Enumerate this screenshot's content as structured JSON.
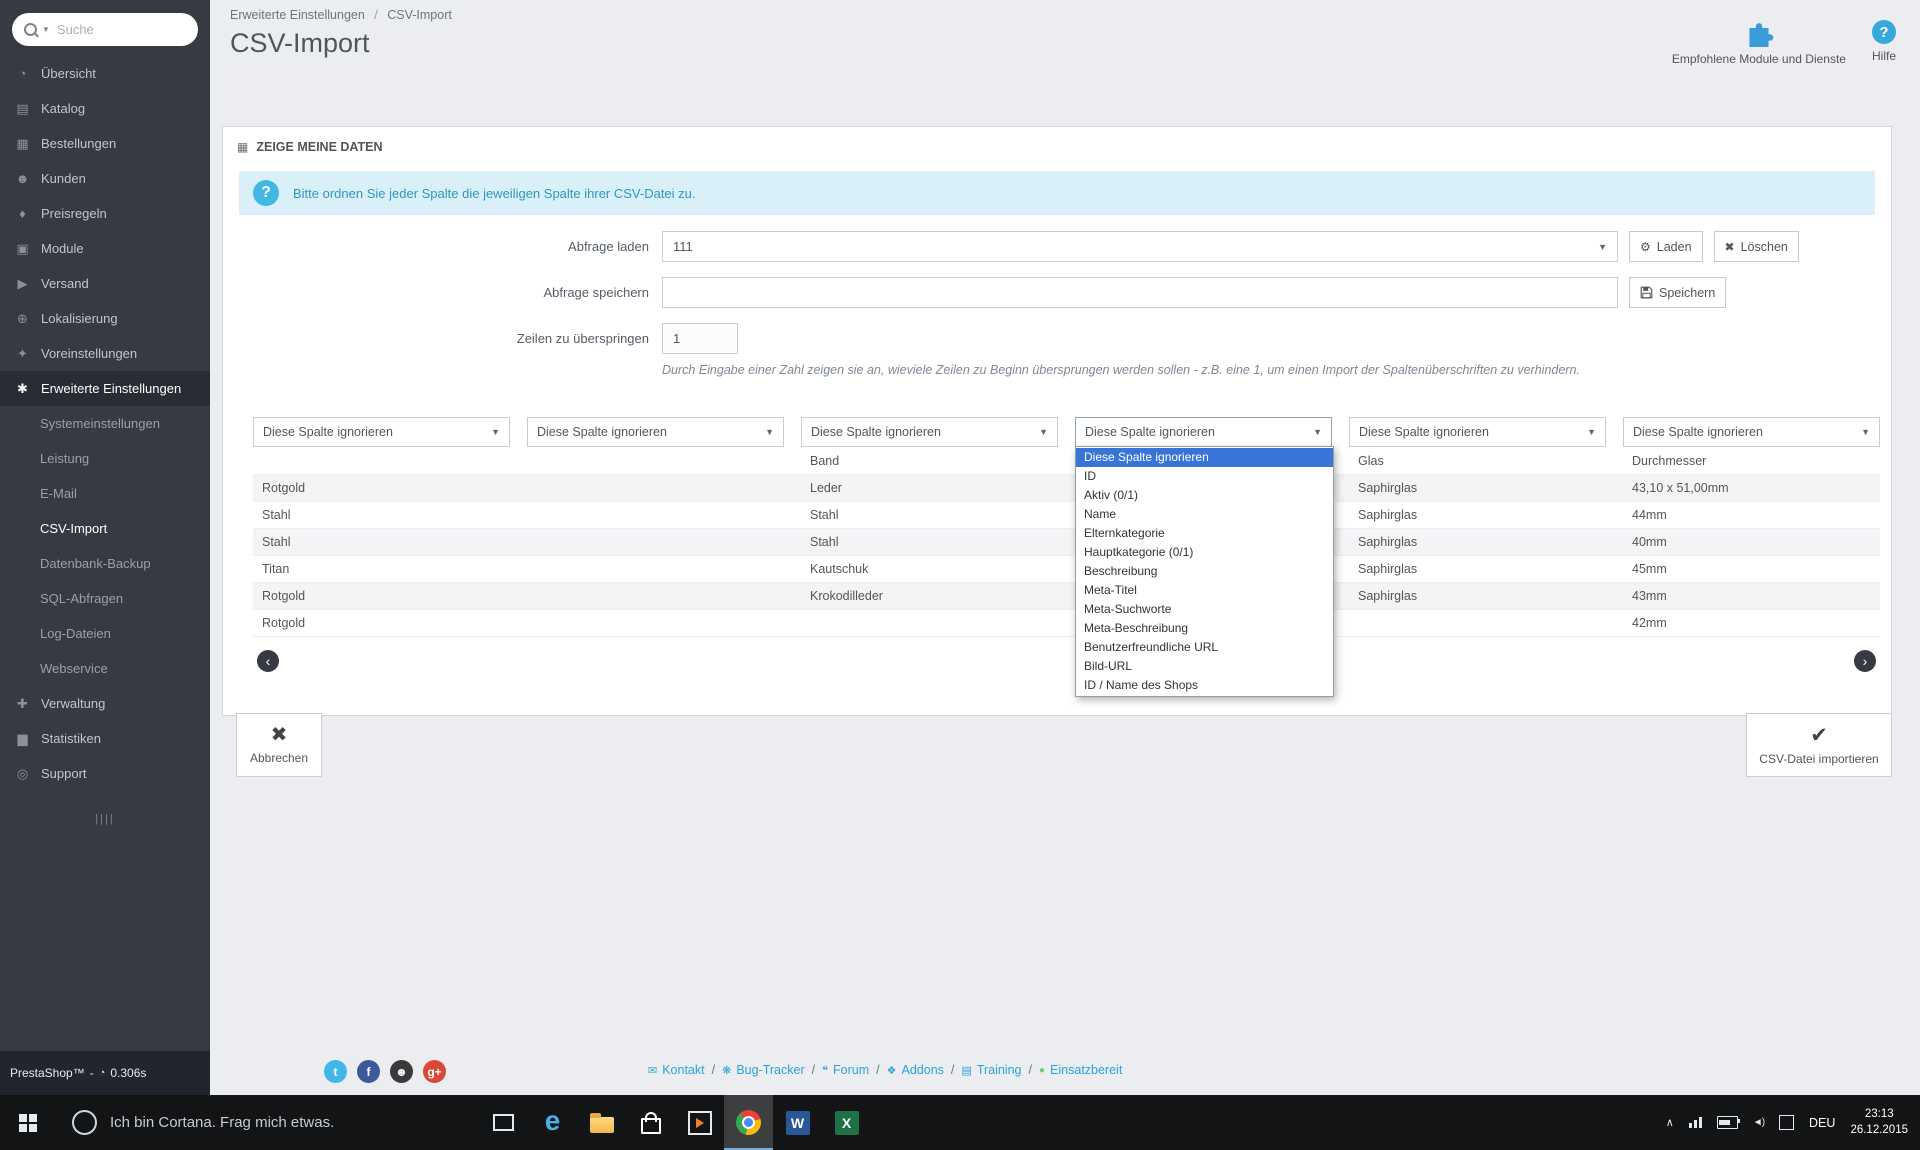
{
  "sidebar": {
    "search_placeholder": "Suche",
    "menu": [
      {
        "label": "Übersicht",
        "icon": "dashboard-icon",
        "type": "main"
      },
      {
        "label": "Katalog",
        "icon": "catalog-icon",
        "type": "main"
      },
      {
        "label": "Bestellungen",
        "icon": "orders-icon",
        "type": "main"
      },
      {
        "label": "Kunden",
        "icon": "customers-icon",
        "type": "main"
      },
      {
        "label": "Preisregeln",
        "icon": "price-rules-icon",
        "type": "main"
      },
      {
        "label": "Module",
        "icon": "modules-icon",
        "type": "main"
      },
      {
        "label": "Versand",
        "icon": "shipping-icon",
        "type": "main"
      },
      {
        "label": "Lokalisierung",
        "icon": "localization-icon",
        "type": "main"
      },
      {
        "label": "Voreinstellungen",
        "icon": "preferences-icon",
        "type": "main"
      },
      {
        "label": "Erweiterte Einstellungen",
        "icon": "advanced-settings-icon",
        "type": "main",
        "active": true
      },
      {
        "label": "Systemeinstellungen",
        "type": "sub"
      },
      {
        "label": "Leistung",
        "type": "sub"
      },
      {
        "label": "E-Mail",
        "type": "sub"
      },
      {
        "label": "CSV-Import",
        "type": "sub",
        "active": true
      },
      {
        "label": "Datenbank-Backup",
        "type": "sub"
      },
      {
        "label": "SQL-Abfragen",
        "type": "sub"
      },
      {
        "label": "Log-Dateien",
        "type": "sub"
      },
      {
        "label": "Webservice",
        "type": "sub"
      },
      {
        "label": "Verwaltung",
        "icon": "administration-icon",
        "type": "main"
      },
      {
        "label": "Statistiken",
        "icon": "stats-icon",
        "type": "main"
      },
      {
        "label": "Support",
        "icon": "support-icon",
        "type": "main"
      }
    ],
    "footer": {
      "brand": "PrestaShop™",
      "separator": "-",
      "load_time": "0.306s"
    }
  },
  "header": {
    "breadcrumb_parent": "Erweiterte Einstellungen",
    "breadcrumb_separator": "/",
    "breadcrumb_current": "CSV-Import",
    "title": "CSV-Import",
    "modules_label": "Empfohlene Module und Dienste",
    "help_label": "Hilfe"
  },
  "panel": {
    "heading": "ZEIGE MEINE DATEN",
    "alert_text": "Bitte ordnen Sie jeder Spalte die jeweiligen Spalte ihrer CSV-Datei zu.",
    "form": {
      "load_label": "Abfrage laden",
      "load_value": "111",
      "load_button": "Laden",
      "delete_button": "Löschen",
      "save_label": "Abfrage speichern",
      "save_value": "",
      "save_button": "Speichern",
      "skip_label": "Zeilen zu überspringen",
      "skip_value": "1",
      "skip_help": "Durch Eingabe einer Zahl zeigen sie an, wieviele Zeilen zu Beginn übersprungen werden sollen - z.B. eine 1, um einen Import der Spaltenüberschriften zu verhindern."
    },
    "mapping": {
      "ignore_label": "Diese Spalte ignorieren",
      "column_count": 6,
      "open_column_index": 3,
      "dropdown": {
        "selected_index": 0,
        "options": [
          "Diese Spalte ignorieren",
          "ID",
          "Aktiv (0/1)",
          "Name",
          "Elternkategorie",
          "Hauptkategorie (0/1)",
          "Beschreibung",
          "Meta-Titel",
          "Meta-Suchworte",
          "Meta-Beschreibung",
          "Benutzerfreundliche URL",
          "Bild-URL",
          "ID / Name des Shops"
        ]
      },
      "rows": [
        [
          "",
          "",
          "Band",
          "",
          "Glas",
          "Durchmesser"
        ],
        [
          "Rotgold",
          "",
          "Leder",
          "",
          "Saphirglas",
          "43,10 x 51,00mm"
        ],
        [
          "Stahl",
          "",
          "Stahl",
          "",
          "Saphirglas",
          "44mm"
        ],
        [
          "Stahl",
          "",
          "Stahl",
          "",
          "Saphirglas",
          "40mm"
        ],
        [
          "Titan",
          "",
          "Kautschuk",
          "",
          "Saphirglas",
          "45mm"
        ],
        [
          "Rotgold",
          "",
          "Krokodilleder",
          "",
          "Saphirglas",
          "43mm"
        ],
        [
          "Rotgold",
          "",
          "",
          "",
          "",
          "42mm"
        ]
      ]
    }
  },
  "actions": {
    "cancel_label": "Abbrechen",
    "import_label": "CSV-Datei importieren"
  },
  "footer": {
    "social": [
      "twitter-icon",
      "facebook-icon",
      "github-icon",
      "googleplus-icon"
    ],
    "separator": "/",
    "links": [
      {
        "label": "Kontakt",
        "icon": "mail-icon"
      },
      {
        "label": "Bug-Tracker",
        "icon": "bug-icon"
      },
      {
        "label": "Forum",
        "icon": "forum-icon"
      },
      {
        "label": "Addons",
        "icon": "addons-icon"
      },
      {
        "label": "Training",
        "icon": "training-icon"
      },
      {
        "label": "Einsatzbereit",
        "icon": "status-dot-icon"
      }
    ]
  },
  "taskbar": {
    "cortana_text": "Ich bin Cortana. Frag mich etwas.",
    "language": "DEU",
    "time": "23:13",
    "date": "26.12.2015"
  }
}
